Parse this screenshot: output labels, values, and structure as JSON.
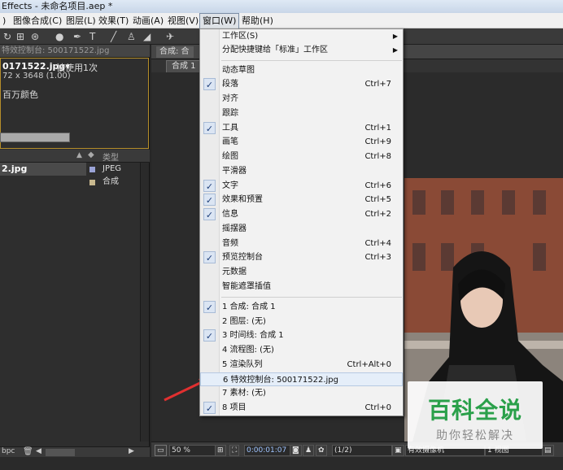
{
  "window": {
    "title": "Effects - 未命名项目.aep *"
  },
  "menubar": {
    "items": [
      ")",
      "图像合成(C)",
      "图层(L)",
      "效果(T)",
      "动画(A)",
      "视图(V)",
      "窗口(W)",
      "帮助(H)"
    ]
  },
  "left_panel": {
    "tab_label": "特效控制台: 500171522.jpg",
    "file_name": "0171522.jpg▾",
    "used_label": "被使用1次",
    "dimensions": "72 x 3648 (1.00)",
    "color_label": "百万颜色",
    "col_type_header": "类型",
    "rows": [
      {
        "name": "2.jpg",
        "type": "JPEG",
        "swatch": "#9aa3d6"
      },
      {
        "name": "",
        "type": "合成",
        "swatch": "#c9b98f"
      }
    ],
    "bottom_label": "bpc"
  },
  "comp_panel": {
    "tab_label": "合成: 合",
    "sub_tab": "合成 1",
    "zoom": "50 %",
    "timecode": "0:00:01:07",
    "resolution": "(1/2)",
    "camera": "有效摄像机",
    "view": "1 视图"
  },
  "window_menu": {
    "items": [
      {
        "label": "工作区(S)",
        "shortcut": "",
        "checked": false,
        "submenu": true
      },
      {
        "label": "分配快捷键给「标准」工作区",
        "shortcut": "",
        "checked": false,
        "submenu": true
      },
      {
        "label": "动态草图",
        "shortcut": "",
        "checked": false
      },
      {
        "label": "段落",
        "shortcut": "Ctrl+7",
        "checked": true
      },
      {
        "label": "对齐",
        "shortcut": "",
        "checked": false
      },
      {
        "label": "跟踪",
        "shortcut": "",
        "checked": false
      },
      {
        "label": "工具",
        "shortcut": "Ctrl+1",
        "checked": true
      },
      {
        "label": "画笔",
        "shortcut": "Ctrl+9",
        "checked": false
      },
      {
        "label": "绘图",
        "shortcut": "Ctrl+8",
        "checked": false
      },
      {
        "label": "平滑器",
        "shortcut": "",
        "checked": false
      },
      {
        "label": "文字",
        "shortcut": "Ctrl+6",
        "checked": true
      },
      {
        "label": "效果和预置",
        "shortcut": "Ctrl+5",
        "checked": true
      },
      {
        "label": "信息",
        "shortcut": "Ctrl+2",
        "checked": true
      },
      {
        "label": "摇摆器",
        "shortcut": "",
        "checked": false
      },
      {
        "label": "音频",
        "shortcut": "Ctrl+4",
        "checked": false
      },
      {
        "label": "预览控制台",
        "shortcut": "Ctrl+3",
        "checked": true
      },
      {
        "label": "元数据",
        "shortcut": "",
        "checked": false
      },
      {
        "label": "智能遮罩插值",
        "shortcut": "",
        "checked": false
      },
      {
        "label": "1 合成: 合成 1",
        "shortcut": "",
        "checked": true
      },
      {
        "label": "2 图层: (无)",
        "shortcut": "",
        "checked": false
      },
      {
        "label": "3 时间线: 合成 1",
        "shortcut": "",
        "checked": true
      },
      {
        "label": "4 流程图: (无)",
        "shortcut": "",
        "checked": false
      },
      {
        "label": "5 渲染队列",
        "shortcut": "Ctrl+Alt+0",
        "checked": false
      },
      {
        "label": "6 特效控制台: 500171522.jpg",
        "shortcut": "",
        "checked": false,
        "highlighted": true
      },
      {
        "label": "7 素材: (无)",
        "shortcut": "",
        "checked": false
      },
      {
        "label": "8 项目",
        "shortcut": "Ctrl+0",
        "checked": true
      }
    ]
  },
  "watermark": {
    "title": "百科全说",
    "subtitle": "助你轻松解决"
  },
  "colors": {
    "accent_border": "#b58e2a",
    "arrow": "#e03030",
    "watermark_green": "#2aa04a"
  }
}
